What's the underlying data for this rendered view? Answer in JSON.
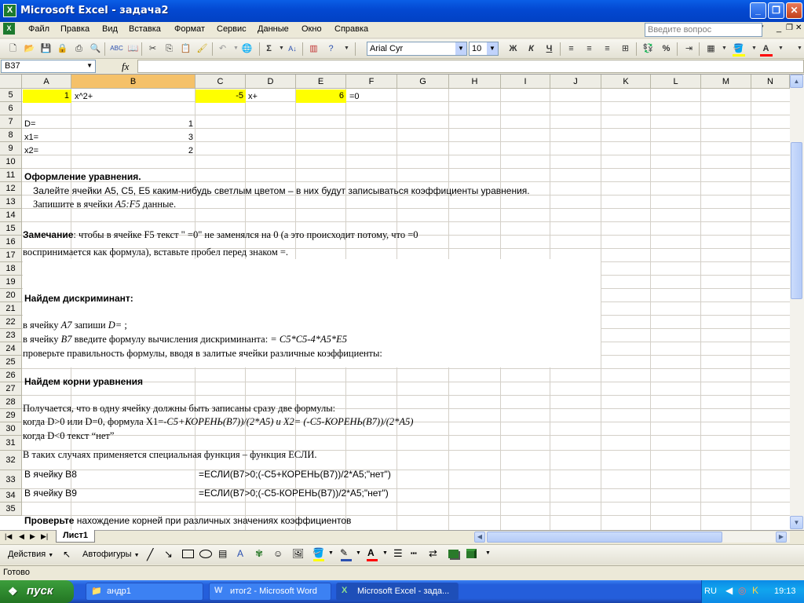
{
  "window": {
    "title": "Microsoft Excel - задача2",
    "min": "_",
    "max": "❐",
    "close": "✕"
  },
  "menu": {
    "items": [
      "Файл",
      "Правка",
      "Вид",
      "Вставка",
      "Формат",
      "Сервис",
      "Данные",
      "Окно",
      "Справка"
    ],
    "help_placeholder": "Введите вопрос"
  },
  "toolbar": {
    "font": "Arial Cyr",
    "size": "10",
    "bold": "Ж",
    "italic": "К",
    "underline": "Ч",
    "sigma": "Σ",
    "percent": "%"
  },
  "formula_bar": {
    "namebox": "B37",
    "fx": "fx",
    "value": ""
  },
  "columns": [
    "A",
    "B",
    "C",
    "D",
    "E",
    "F",
    "G",
    "H",
    "I",
    "J",
    "K",
    "L",
    "M",
    "N"
  ],
  "rows": [
    "5",
    "6",
    "7",
    "8",
    "9",
    "10",
    "11",
    "12",
    "13",
    "14",
    "15",
    "16",
    "17",
    "18",
    "19",
    "20",
    "21",
    "22",
    "23",
    "24",
    "25",
    "26",
    "27",
    "28",
    "29",
    "30",
    "31",
    "32",
    "33",
    "34",
    "35"
  ],
  "cells": {
    "a5": "1",
    "b5": "x^2+",
    "c5": "-5",
    "d5": "x+",
    "e5": "6",
    "f5": "=0",
    "a7": "D=",
    "b7": "1",
    "a8": "x1=",
    "b8": "3",
    "a9": "x2=",
    "b9": "2"
  },
  "text": {
    "r11": "Оформление уравнения.",
    "r12": "Залейте ячейки А5, С5, Е5 каким-нибудь светлым цветом – в них будут записываться коэффициенты уравнения.",
    "r13a": "Запишите в ячейки ",
    "r13b": "A5:F5",
    "r13c": " данные.",
    "r15a": "Замечание",
    "r15b": ": чтобы в ячейке F5 текст \" =0\" не заменялся на 0 (а это происходит потому, что =0",
    "r17": "воспринимается как формула), вставьте пробел перед знаком =.",
    "r20": "Найдем дискриминант:",
    "r22a": "в ячейку ",
    "r22b": "A7",
    "r22c": " запиши ",
    "r22d": "D=",
    "r22e": " ;",
    "r23a": "в ячейку ",
    "r23b": "B7",
    "r23c": " введите формулу вычисления дискриминанта: ",
    "r23d": "= C5*C5-4*A5*E5",
    "r24": "проверьте правильность формулы, вводя в залитые ячейки различные коэффициенты:",
    "r26": "Найдем корни уравнения",
    "r28": "Получается, что в одну ячейку должны быть записаны сразу две формулы:",
    "r29a": "когда D>0 или D=0, формула X1=",
    "r29b": "-C5+КОРЕНЬ(B7))/(2*A5) и X2= (-C5-КОРЕНЬ(B7))/(2*A5)",
    "r30": "когда D<0 текст “нет”",
    "r31": "В таких случаях применяется специальная функция – функция ЕСЛИ.",
    "r32a": "В ячейку В8",
    "r32b": "=ЕСЛИ(B7>0;(-C5+КОРЕНЬ(B7))/2*A5;\"нет\")",
    "r33a": "В ячейку В9",
    "r33b": "=ЕСЛИ(B7>0;(-C5-КОРЕНЬ(B7))/2*A5;\"нет\")",
    "r35a": "Проверьте",
    "r35b": " нахождение корней при различных значениях коэффициентов"
  },
  "sheet_tab": "Лист1",
  "drawing": {
    "actions": "Действия",
    "autoshapes": "Автофигуры"
  },
  "status": "Готово",
  "taskbar": {
    "start": "пуск",
    "tasks": [
      "андр1",
      "итог2 - Microsoft Word",
      "Microsoft Excel - зада..."
    ],
    "lang": "RU",
    "clock": "19:13"
  },
  "colors": {
    "highlight": "#ffff00",
    "selected_header": "#f5c169",
    "title_blue": "#0348d1"
  }
}
